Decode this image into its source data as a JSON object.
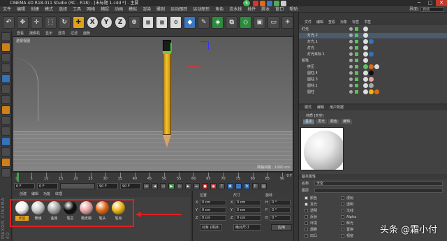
{
  "window": {
    "title": "CINEMA 4D R18.011 Studio (RC - R18) - [未标题 1.c4d *] - 主要",
    "controls": [
      "─",
      "□",
      "✕"
    ],
    "notification_badge": "5"
  },
  "menubar": {
    "items": [
      "文件",
      "编辑",
      "创建",
      "模式",
      "选择",
      "工具",
      "网格",
      "捕捉",
      "动画",
      "模拟",
      "渲染",
      "雕刻",
      "运动跟踪",
      "运动图形",
      "角色",
      "流水线",
      "插件",
      "脚本",
      "窗口",
      "帮助"
    ],
    "layout_label": "界面:",
    "layout_value": "启动"
  },
  "toolbar": {
    "axis_x": "X",
    "axis_y": "Y",
    "axis_z": "Z"
  },
  "viewport": {
    "menus": [
      "查看",
      "摄像机",
      "显示",
      "选项",
      "过滤",
      "面板"
    ],
    "label": "透视视图",
    "grid_spacing": "网格间距 : 1000 cm"
  },
  "timeline": {
    "ticks": [
      "0",
      "5",
      "10",
      "15",
      "20",
      "25",
      "30",
      "35",
      "40",
      "45",
      "50",
      "55",
      "60",
      "65",
      "70",
      "75",
      "80",
      "85",
      "90"
    ],
    "current_frame_label": "0 F",
    "start_frame": "0 F",
    "min_frame": "0 F",
    "end_frame": "90 F",
    "max_frame": "90 F"
  },
  "material_manager": {
    "menus": [
      "创建",
      "编辑",
      "功能",
      "纹理"
    ],
    "materials": [
      {
        "label": "天空",
        "color": "#f2f2f2",
        "selected": true
      },
      {
        "label": "玻璃",
        "color": "#c9c9c9",
        "selected": false
      },
      {
        "label": "金属",
        "color": "#a8a8a8",
        "selected": false
      },
      {
        "label": "笔芯",
        "color": "#0d0d0d",
        "selected": false
      },
      {
        "label": "橡皮擦",
        "color": "#e6a3a3",
        "selected": false
      },
      {
        "label": "笔头",
        "color": "#e06a14",
        "selected": false
      },
      {
        "label": "笔身",
        "color": "#f0b515",
        "selected": false
      }
    ]
  },
  "coordinates": {
    "headers": [
      "位置",
      "尺寸",
      "旋转"
    ],
    "rows": [
      {
        "axis": "X",
        "pos": "0 cm",
        "size_axis": "X",
        "size": "0 cm",
        "rot_axis": "H",
        "rot": "0 °"
      },
      {
        "axis": "Y",
        "pos": "0 cm",
        "size_axis": "Y",
        "size": "0 cm",
        "rot_axis": "P",
        "rot": "0 °"
      },
      {
        "axis": "Z",
        "pos": "0 cm",
        "size_axis": "Z",
        "size": "0 cm",
        "rot_axis": "B",
        "rot": "0 °"
      }
    ],
    "mode": "对象 (相对)",
    "size_mode": "绝对尺寸",
    "apply": "应用"
  },
  "object_manager": {
    "menus": [
      "文件",
      "编辑",
      "查看",
      "对象",
      "标签",
      "书签"
    ],
    "objects": [
      {
        "name": "灯光",
        "indent": 0,
        "selected": false
      },
      {
        "name": "灯光.2",
        "indent": 1,
        "selected": true
      },
      {
        "name": "灯光.1",
        "indent": 1,
        "selected": false
      },
      {
        "name": "灯光",
        "indent": 1,
        "selected": false
      },
      {
        "name": "灯光目标.1",
        "indent": 1,
        "selected": false
      },
      {
        "name": "铅笔",
        "indent": 0,
        "selected": false
      },
      {
        "name": "挤压",
        "indent": 1,
        "selected": false
      },
      {
        "name": "圆柱.4",
        "indent": 1,
        "selected": false
      },
      {
        "name": "圆柱.3",
        "indent": 1,
        "selected": false
      },
      {
        "name": "圆柱.1",
        "indent": 1,
        "selected": false
      },
      {
        "name": "圆柱",
        "indent": 1,
        "selected": false
      }
    ]
  },
  "attribute_manager": {
    "menus": [
      "模式",
      "编辑",
      "用户数据"
    ],
    "material_name": "材质 [天空]",
    "tabs": [
      "基本",
      "发光",
      "颜色",
      "编辑"
    ],
    "section": "基本属性",
    "name_label": "名称",
    "name_value": "天空",
    "layer_label": "图层",
    "channels_left": [
      "颜色",
      "发光",
      "透明",
      "反射",
      "环境",
      "烟雾",
      "凹凸"
    ],
    "channels_right": [
      "漫射",
      "透明",
      "法线",
      "Alpha",
      "辉光",
      "置换",
      "视窗"
    ]
  },
  "watermark": "头条 @霜小付"
}
